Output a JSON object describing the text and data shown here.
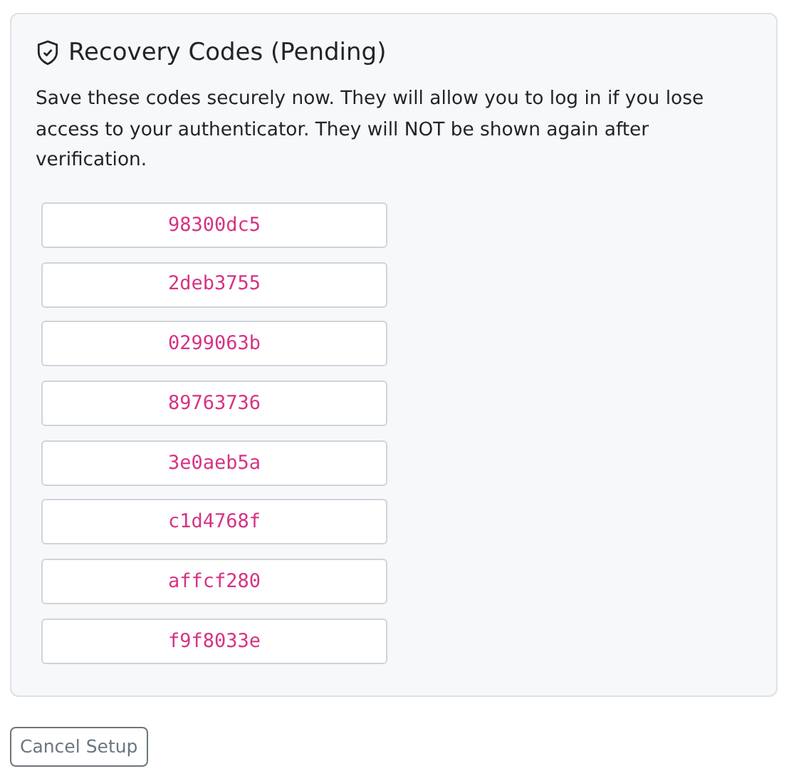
{
  "card": {
    "title": "Recovery Codes (Pending)",
    "description": "Save these codes securely now. They will allow you to log in if you lose access to your authenticator. They will NOT be shown again after verification.",
    "codes": [
      "98300dc5",
      "2deb3755",
      "0299063b",
      "89763736",
      "3e0aeb5a",
      "c1d4768f",
      "affcf280",
      "f9f8033e"
    ]
  },
  "buttons": [
    {
      "label": "Cancel Setup"
    }
  ]
}
